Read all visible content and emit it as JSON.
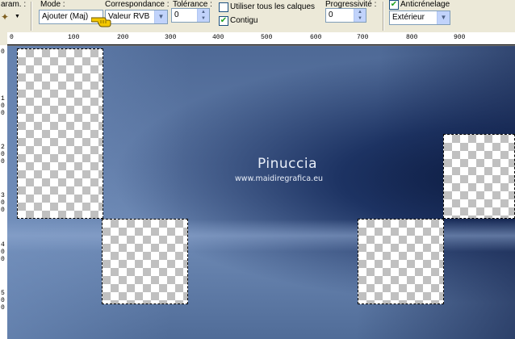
{
  "toolbar": {
    "params_label": "aram. :",
    "mode": {
      "label": "Mode :",
      "value": "Ajouter (Maj)"
    },
    "correspondance": {
      "label": "Correspondance :",
      "value": "Valeur RVB"
    },
    "tolerance": {
      "label": "Tolérance :",
      "value": "0"
    },
    "use_all_layers": {
      "label": "Utiliser tous les calques",
      "checked": false
    },
    "contigu": {
      "label": "Contigu",
      "checked": true
    },
    "progressivite": {
      "label": "Progressivité :",
      "value": "0"
    },
    "anticrenelage": {
      "label": "Anticrénelage",
      "checked": true,
      "value": "Extérieur"
    }
  },
  "ruler_h": {
    "labels": [
      "0",
      "100",
      "200",
      "300",
      "400",
      "500",
      "600",
      "700",
      "800",
      "900"
    ]
  },
  "ruler_v": {
    "labels": [
      "0",
      "1\n0\n0",
      "2\n0\n0",
      "3\n0\n0",
      "4\n0\n0",
      "5\n0\n0"
    ]
  },
  "watermark": {
    "title": "Pinuccia",
    "url": "www.maidiregrafica.eu"
  },
  "colors": {
    "toolbar_bg": "#ece9d8",
    "canvas_dark": "#1d3363",
    "canvas_light": "#6e8ab5"
  }
}
